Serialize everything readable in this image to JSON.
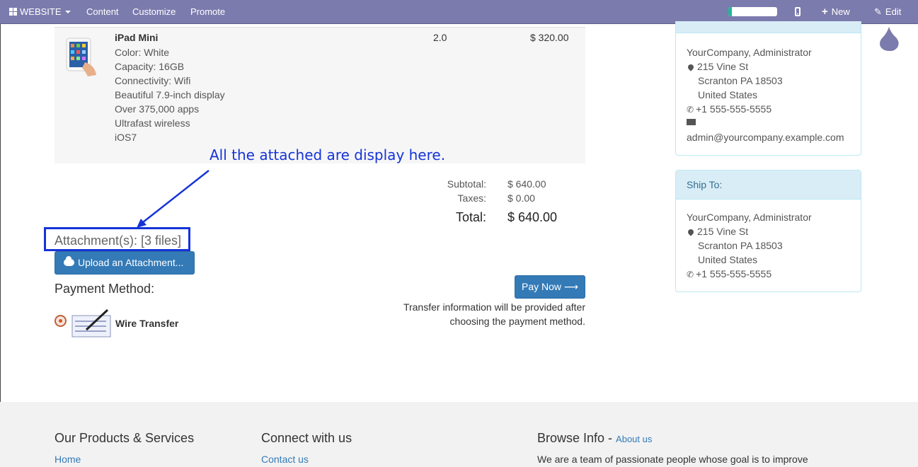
{
  "topbar": {
    "website_label": "WEBSITE",
    "menu": [
      "Content",
      "Customize",
      "Promote"
    ],
    "progress": 0.07,
    "new_label": "New",
    "edit_label": "Edit",
    "bg_color": "#7c7bad"
  },
  "order": {
    "product": {
      "name": "iPad Mini",
      "attributes": [
        "Color: White",
        "Capacity: 16GB",
        "Connectivity: Wifi",
        "Beautiful 7.9-inch display",
        "Over 375,000 apps",
        "Ultrafast wireless",
        "iOS7"
      ],
      "quantity": "2.0",
      "price": "$ 320.00"
    },
    "subtotal_label": "Subtotal:",
    "subtotal_value": "$ 640.00",
    "taxes_label": "Taxes:",
    "taxes_value": "$ 0.00",
    "total_label": "Total:",
    "total_value": "$ 640.00"
  },
  "annotation": {
    "text": "All the attached are display here.",
    "color": "#1534d8"
  },
  "attachments": {
    "label": "Attachment(s): [3 files]",
    "upload_button": "Upload an Attachment..."
  },
  "payment": {
    "title": "Payment Method:",
    "method": "Wire Transfer",
    "pay_button": "Pay Now ⟶",
    "info_line1": "Transfer information will be provided after",
    "info_line2": "choosing the payment method."
  },
  "bill_to": {
    "name": "YourCompany, Administrator",
    "street": "215 Vine St",
    "city": "Scranton PA 18503",
    "country": "United States",
    "phone": "+1 555-555-5555",
    "email": "admin@yourcompany.example.com"
  },
  "ship_to": {
    "title": "Ship To:",
    "name": "YourCompany, Administrator",
    "street": "215 Vine St",
    "city": "Scranton PA 18503",
    "country": "United States",
    "phone": "+1 555-555-5555"
  },
  "footer": {
    "products_title": "Our Products & Services",
    "products_link": "Home",
    "connect_title": "Connect with us",
    "connect_link": "Contact us",
    "browse_title": "Browse Info",
    "browse_link": "About us",
    "browse_text": "We are a team of passionate people whose goal is to improve"
  }
}
